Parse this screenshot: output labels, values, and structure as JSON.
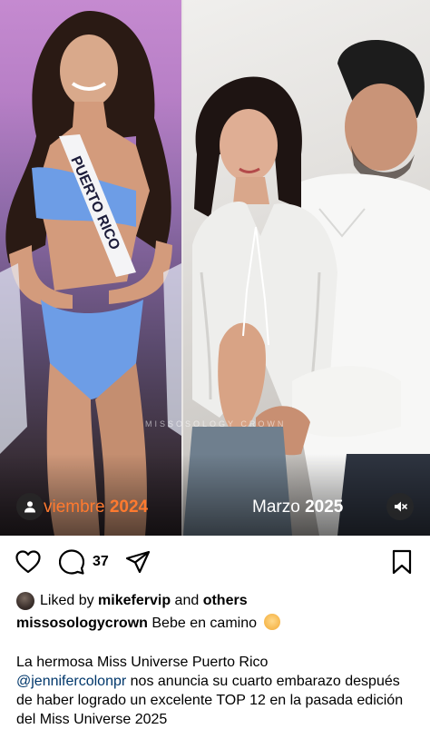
{
  "post": {
    "left_panel": {
      "date_month": "viembre",
      "date_year": "2024",
      "sash_text": "PUERTO RICO"
    },
    "right_panel": {
      "date_month": "Marzo",
      "date_year": "2025"
    },
    "watermark": "MISSOSOLOGY CROWN",
    "accent_color": "#ff7a2f"
  },
  "actions": {
    "comment_count": "37",
    "icons": [
      "heart-icon",
      "comment-icon",
      "share-icon",
      "bookmark-icon"
    ]
  },
  "likes": {
    "prefix": "Liked by",
    "user": "mikefervip",
    "middle": "and",
    "others": "others"
  },
  "caption": {
    "username": "missosologycrown",
    "text": "Bebe en camino"
  },
  "body": {
    "line_start": "La hermosa Miss Universe Puerto Rico",
    "mention": "@jennifercolonpr",
    "line_rest": "nos anuncia su cuarto embarazo después de haber logrado un excelente TOP 12 en la pasada edición del Miss Universe 2025"
  }
}
